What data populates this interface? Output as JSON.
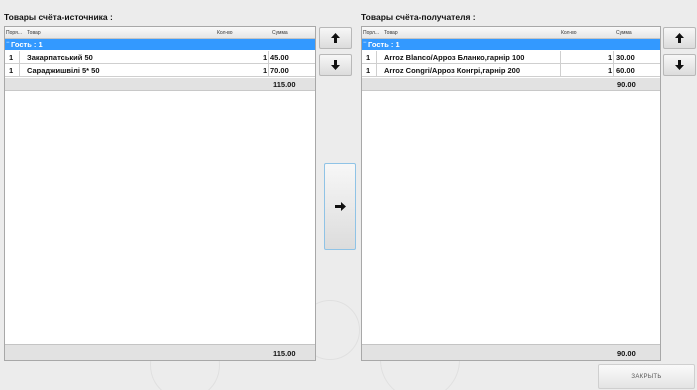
{
  "source": {
    "title": "Товары счёта-источника :",
    "columns": {
      "order": "Поря...",
      "item": "Товар",
      "qty": "Кол-во",
      "sum": "Сумма"
    },
    "group_label": "Гость : 1",
    "group_expander": "−",
    "rows": [
      {
        "order": "1",
        "item": "Закарпатський 50",
        "qty": "1",
        "sum": "45.00"
      },
      {
        "order": "1",
        "item": "Сараджишвілі 5* 50",
        "qty": "1",
        "sum": "70.00"
      }
    ],
    "group_total": "115.00",
    "footer_total": "115.00"
  },
  "target": {
    "title": "Товары счёта-получателя :",
    "columns": {
      "order": "Порл...",
      "item": "Товар",
      "qty": "Кол-во",
      "sum": "Сумма"
    },
    "group_label": "Гость : 1",
    "group_expander": "−",
    "rows": [
      {
        "order": "1",
        "item": "Arroz Blanco/Арроз Бланко,гарнір 100",
        "qty": "1",
        "sum": "30.00"
      },
      {
        "order": "1",
        "item": "Arroz Congri/Арроз Конгрі,гарнір 200",
        "qty": "1",
        "sum": "60.00"
      }
    ],
    "group_total": "90.00",
    "footer_total": "90.00"
  },
  "buttons": {
    "close_label": "ЗАКРЫТЬ",
    "up_icon": "arrow-up-icon",
    "down_icon": "arrow-down-icon",
    "move_icon": "arrow-right-icon"
  }
}
